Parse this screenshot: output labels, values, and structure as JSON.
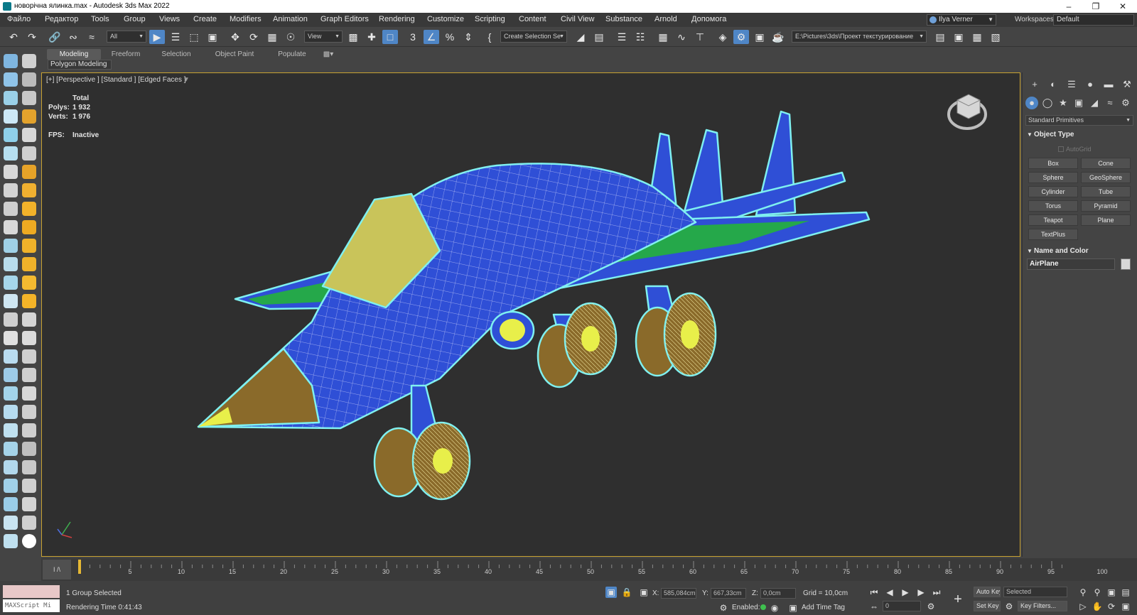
{
  "window": {
    "title": "новорічна ялинка.max - Autodesk 3ds Max 2022"
  },
  "menu": {
    "items": [
      "Файло",
      "Редактор",
      "Tools",
      "Group",
      "Views",
      "Create",
      "Modifiers",
      "Animation",
      "Graph Editors",
      "Rendering",
      "Customize",
      "Scripting",
      "Content",
      "Civil View",
      "Substance",
      "Arnold",
      "Допомога"
    ],
    "user": "Ilya Verner",
    "workspaces_label": "Workspaces:",
    "workspaces_value": "Default"
  },
  "toolbar": {
    "filter_value": "All",
    "view_value": "View",
    "selection_set_placeholder": "Create Selection Se",
    "project_path": "E:\\Pictures\\3ds\\Проект текстурирование"
  },
  "ribbon": {
    "tabs": [
      "Modeling",
      "Freeform",
      "Selection",
      "Object Paint",
      "Populate"
    ],
    "active_tab": "Modeling",
    "sub_label": "Polygon Modeling"
  },
  "viewport": {
    "label": "[+] [Perspective ] [Standard ] [Edged Faces ]",
    "stats": {
      "total_label": "Total",
      "polys_label": "Polys:",
      "polys_value": "1 932",
      "verts_label": "Verts:",
      "verts_value": "1 976",
      "fps_label": "FPS:",
      "fps_value": "Inactive"
    },
    "colors": {
      "body": "#2f4fd6",
      "wing_stripe": "#25a84a",
      "canopy": "#c9c45a",
      "nose": "#8a6a2a",
      "hub": "#e8ef4a",
      "selection_outline": "#7ff0f0",
      "grid_line": "#e6e6ff"
    }
  },
  "command_panel": {
    "category": "Standard Primitives",
    "object_type_label": "Object Type",
    "autogrid_label": "AutoGrid",
    "buttons": [
      "Box",
      "Cone",
      "Sphere",
      "GeoSphere",
      "Cylinder",
      "Tube",
      "Torus",
      "Pyramid",
      "Teapot",
      "Plane",
      "TextPlus"
    ],
    "name_color_label": "Name and Color",
    "object_name": "AirPlane"
  },
  "timeline": {
    "slider_label": "I /\\",
    "ticks": [
      "5",
      "10",
      "15",
      "20",
      "25",
      "30",
      "35",
      "40",
      "45",
      "50",
      "55",
      "60",
      "65",
      "70",
      "75",
      "80",
      "85",
      "90",
      "95",
      "100"
    ]
  },
  "status": {
    "maxscript_label": "MAXScript Mi",
    "selection_info": "1 Group Selected",
    "render_time": "Rendering Time  0:41:43",
    "x_label": "X:",
    "x_value": "585,084cm",
    "y_label": "Y:",
    "y_value": "667,33cm",
    "z_label": "Z:",
    "z_value": "0,0cm",
    "grid": "Grid = 10,0cm",
    "enabled_label": "Enabled:",
    "add_time_tag": "Add Time Tag",
    "frame_value": "0",
    "auto_key": "Auto Key",
    "set_key": "Set Key",
    "selected_value": "Selected",
    "key_filters": "Key Filters..."
  }
}
